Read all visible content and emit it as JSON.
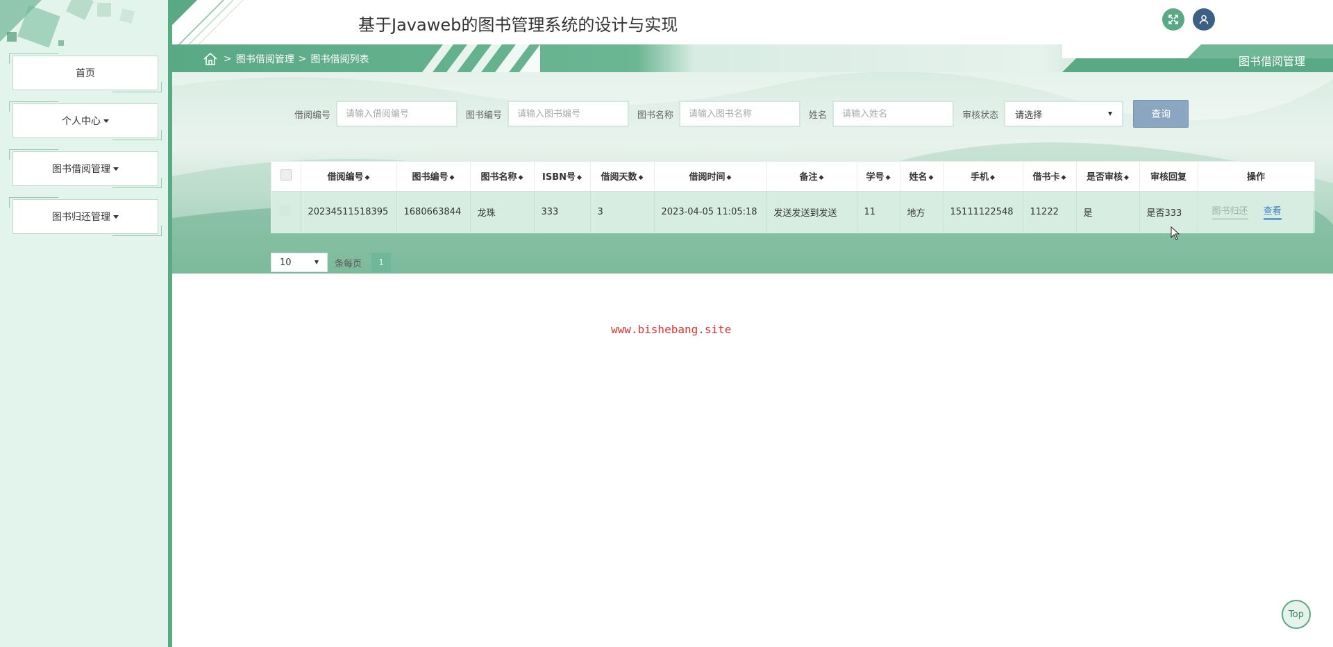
{
  "header": {
    "title": "基于Javaweb的图书管理系统的设计与实现"
  },
  "sidebar": {
    "items": [
      {
        "label": "首页",
        "dropdown": false
      },
      {
        "label": "个人中心",
        "dropdown": true
      },
      {
        "label": "图书借阅管理",
        "dropdown": true
      },
      {
        "label": "图书归还管理",
        "dropdown": true
      }
    ]
  },
  "breadcrumb": {
    "sep": ">",
    "items": [
      "图书借阅管理",
      "图书借阅列表"
    ],
    "right_title": "图书借阅管理"
  },
  "search": {
    "fields": [
      {
        "label": "借阅编号",
        "placeholder": "请输入借阅编号"
      },
      {
        "label": "图书编号",
        "placeholder": "请输入图书编号"
      },
      {
        "label": "图书名称",
        "placeholder": "请输入图书名称"
      },
      {
        "label": "姓名",
        "placeholder": "请输入姓名"
      }
    ],
    "status_label": "审核状态",
    "status_value": "请选择",
    "query_label": "查询"
  },
  "table": {
    "columns": [
      "借阅编号",
      "图书编号",
      "图书名称",
      "ISBN号",
      "借阅天数",
      "借阅时间",
      "备注",
      "学号",
      "姓名",
      "手机",
      "借书卡",
      "是否审核",
      "审核回复",
      "操作"
    ],
    "rows": [
      [
        "20234511518395",
        "1680663844",
        "龙珠",
        "333",
        "3",
        "2023-04-05 11:05:18",
        "发送发送到发送",
        "11",
        "地方",
        "15111122548",
        "11222",
        "是",
        "是否333"
      ]
    ],
    "actions": {
      "return": "图书归还",
      "view": "查看"
    }
  },
  "pager": {
    "page_size": "10",
    "per_page_label": "条每页",
    "current_page": "1"
  },
  "watermark": "www.bishebang.site",
  "top_button": "Top",
  "colors": {
    "primary": "#5aa985",
    "user_button": "#3d5f86",
    "query_button": "#8aa6c0",
    "view_link": "#3b7ec4",
    "watermark": "#e03030"
  }
}
